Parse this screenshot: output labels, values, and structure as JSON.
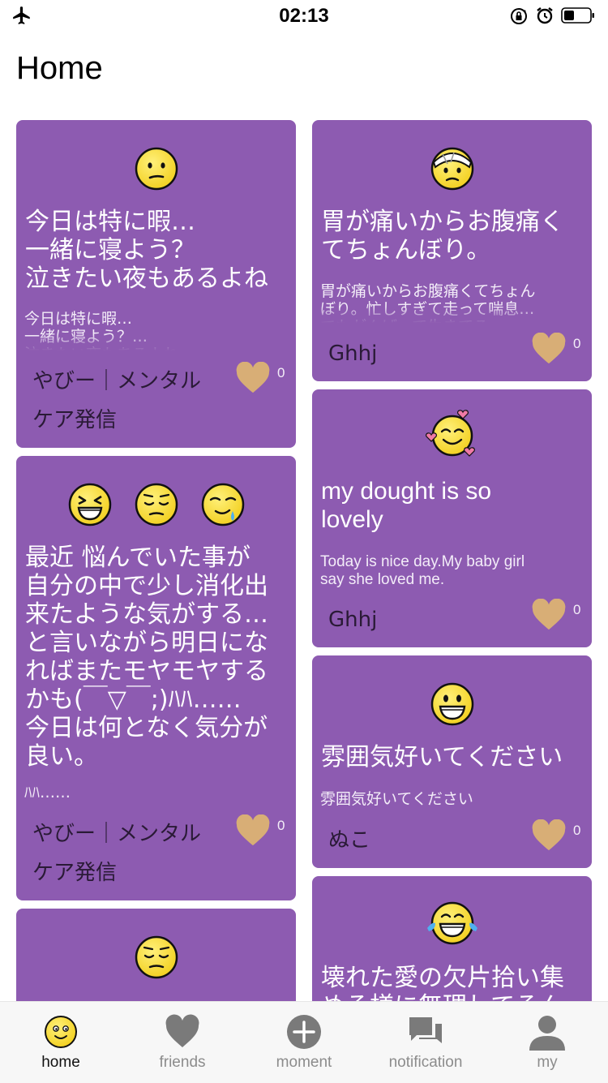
{
  "status_bar": {
    "time": "02:13"
  },
  "header": {
    "title": "Home"
  },
  "posts": [
    {
      "emojis": [
        "neutral-face-icon"
      ],
      "title": "今日は特に暇…\n一緒に寝よう？\n泣きたい夜もあるよね",
      "body": "今日は特に暇…\n一緒に寝よう？…\n泣きたい夜もあるよね",
      "author": "やびー｜メンタル\nケア発信",
      "likes": "0"
    },
    {
      "emojis": [
        "grinning-squint-face-icon",
        "relieved-face-icon",
        "drooling-face-icon"
      ],
      "title": "最近 悩んでいた事が\n自分の中で少し消化出\n来たような気がする…\nと言いながら明日にな\nればまたモヤモヤする\nかも(￣▽￣;)ﾊﾊ……\n今日は何となく気分が\n良い。",
      "body": "ﾊﾊ……",
      "author": "やびー｜メンタル\nケア発信",
      "likes": "0"
    },
    {
      "emojis": [
        "relieved-face-icon"
      ],
      "title": "",
      "body": "",
      "author": "",
      "likes": ""
    },
    {
      "emojis": [
        "bandaged-face-icon"
      ],
      "title": "胃が痛いからお腹痛く\nてちょんぼり。",
      "body": "胃が痛いからお腹痛くてちょん\nぼり。忙しすぎて走って喘息…\nでもがんばって生きてる…",
      "author": "Ghhj",
      "likes": "0"
    },
    {
      "emojis": [
        "smiling-face-with-hearts-icon"
      ],
      "title": "my dought is so\nlovely",
      "body": "Today is nice day.My baby girl\nsay she loved me.",
      "author": "Ghhj",
      "likes": "0"
    },
    {
      "emojis": [
        "grinning-face-icon"
      ],
      "title": "雰囲気好いてください",
      "body": "雰囲気好いてください",
      "author": "ぬこ",
      "likes": "0"
    },
    {
      "emojis": [
        "tears-of-joy-face-icon"
      ],
      "title": "壊れた愛の欠片拾い集\nめる様に無理してるん",
      "body": "",
      "author": "",
      "likes": ""
    }
  ],
  "tab_bar": {
    "tabs": [
      {
        "label": "home",
        "icon": "home-smiley-icon",
        "active": true
      },
      {
        "label": "friends",
        "icon": "heart-icon",
        "active": false
      },
      {
        "label": "moment",
        "icon": "plus-circle-icon",
        "active": false
      },
      {
        "label": "notification",
        "icon": "chat-bubbles-icon",
        "active": false
      },
      {
        "label": "my",
        "icon": "person-icon",
        "active": false
      }
    ]
  },
  "colors": {
    "card_background": "#8d5bb1",
    "like_heart": "#d8ae76",
    "emoji_yellow": "#f7dd3a",
    "tab_active": "#111111",
    "tab_inactive": "#8c8c8c"
  }
}
